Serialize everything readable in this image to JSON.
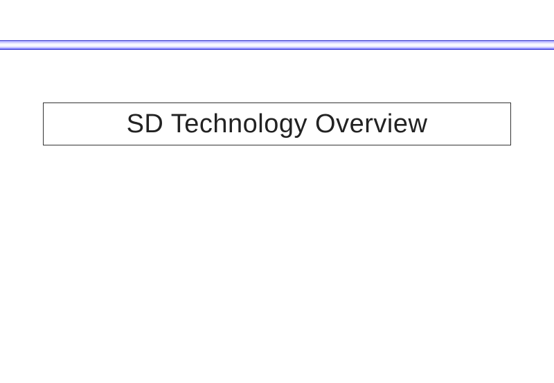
{
  "slide": {
    "title": "SD Technology Overview"
  }
}
